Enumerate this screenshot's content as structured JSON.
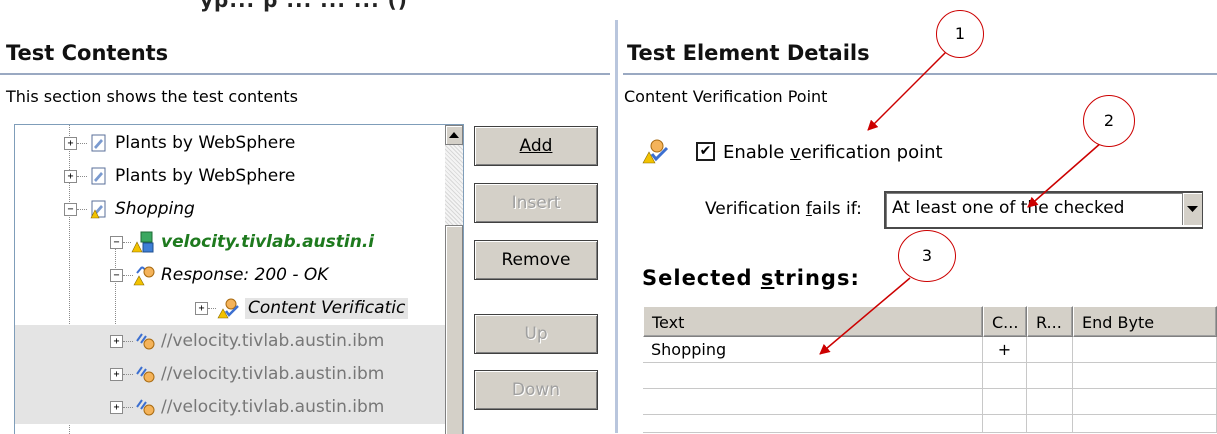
{
  "top_fragment": "yp... p ... ... ... ()",
  "left": {
    "title": "Test Contents",
    "description": "This section shows the test contents",
    "tree": [
      {
        "label": "Plants by WebSphere",
        "style": "normal"
      },
      {
        "label": "Plants by WebSphere",
        "style": "normal"
      },
      {
        "label": "Shopping",
        "style": "italic"
      },
      {
        "label": "velocity.tivlab.austin.i",
        "style": "green"
      },
      {
        "label": "Response: 200 - OK",
        "style": "italic"
      },
      {
        "label": "Content Verificatic",
        "style": "italic"
      },
      {
        "label": "//velocity.tivlab.austin.ibm",
        "style": "gray"
      },
      {
        "label": "//velocity.tivlab.austin.ibm",
        "style": "gray"
      },
      {
        "label": "//velocity.tivlab.austin.ibm",
        "style": "gray"
      }
    ],
    "buttons": {
      "add": "Add",
      "insert": "Insert",
      "remove": "Remove",
      "up": "Up",
      "down": "Down"
    }
  },
  "right": {
    "title": "Test Element Details",
    "description": "Content Verification Point",
    "enable_label_pre": "Enable ",
    "enable_label_accel": "v",
    "enable_label_post": "erification point",
    "enable_checked": true,
    "fails_label_pre": "Verification ",
    "fails_label_accel": "f",
    "fails_label_post": "ails if:",
    "fails_value": "At least one of the checked",
    "selected_pre": "Selected ",
    "selected_accel": "s",
    "selected_post": "trings:",
    "table": {
      "columns": [
        "Text",
        "C...",
        "R...",
        "End Byte"
      ],
      "rows": [
        [
          "Shopping",
          "+",
          "",
          ""
        ]
      ]
    }
  },
  "callouts": [
    "1",
    "2",
    "3"
  ],
  "colors": {
    "callout": "#cc0000",
    "green_label": "#1e7a1e",
    "divider": "#b9c6dd"
  }
}
